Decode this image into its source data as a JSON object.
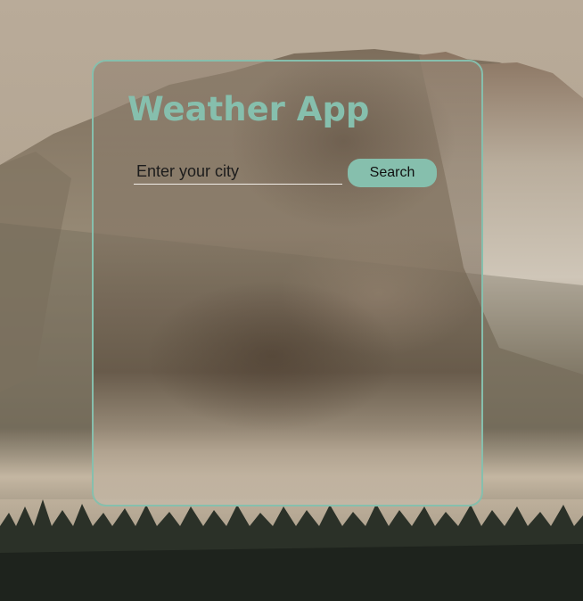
{
  "app": {
    "title": "Weather App"
  },
  "search": {
    "placeholder": "Enter your city",
    "value": "",
    "button_label": "Search"
  },
  "theme": {
    "accent": "#86bfad",
    "input_underline": "#f2eee8"
  }
}
